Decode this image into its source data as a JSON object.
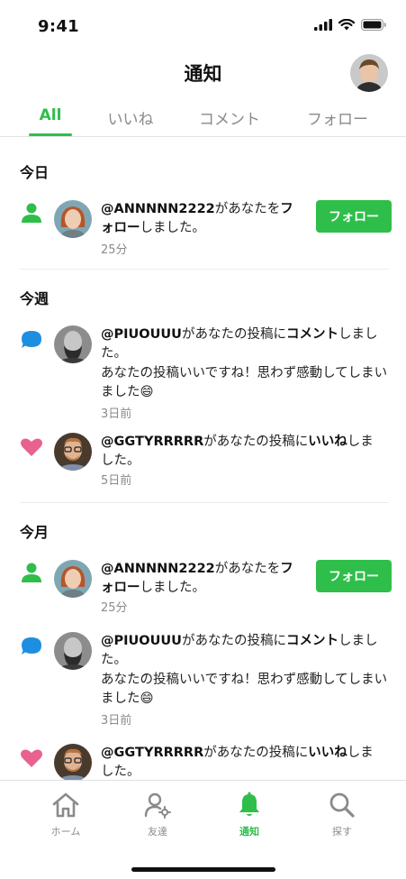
{
  "status": {
    "time": "9:41"
  },
  "header": {
    "title": "通知"
  },
  "tabs": [
    {
      "label": "All",
      "active": true
    },
    {
      "label": "いいね",
      "active": false
    },
    {
      "label": "コメント",
      "active": false
    },
    {
      "label": "フォロー",
      "active": false
    }
  ],
  "sections": {
    "today": "今日",
    "week": "今週",
    "month": "今月"
  },
  "notifications": {
    "follow1": {
      "user": "@ANNNNN2222",
      "pre": "があなたを",
      "action": "フォロー",
      "post": "しました。",
      "time": "25分",
      "button": "フォロー"
    },
    "comment1": {
      "user": "@PIUOUUU",
      "pre": "があなたの投稿に",
      "action": "コメント",
      "post": "しました。",
      "body": "あなたの投稿いいですね！思わず感動してしまいました😄",
      "time": "3日前"
    },
    "like1": {
      "user": "@GGTYRRRRR",
      "pre": "があなたの投稿に",
      "action": "いいね",
      "post": "しました。",
      "time": "5日前"
    },
    "follow2": {
      "user": "@ANNNNN2222",
      "pre": "があなたを",
      "action": "フォロー",
      "post": "しました。",
      "time": "25分",
      "button": "フォロー"
    },
    "comment2": {
      "user": "@PIUOUUU",
      "pre": "があなたの投稿に",
      "action": "コメント",
      "post": "しました。",
      "body": "あなたの投稿いいですね！思わず感動してしまいました😄",
      "time": "3日前"
    },
    "like2": {
      "user": "@GGTYRRRRR",
      "pre": "があなたの投稿に",
      "action": "いいね",
      "post": "しました。"
    }
  },
  "nav": [
    {
      "label": "ホーム",
      "icon": "home-icon"
    },
    {
      "label": "友達",
      "icon": "friends-icon"
    },
    {
      "label": "通知",
      "icon": "bell-icon",
      "active": true
    },
    {
      "label": "探す",
      "icon": "search-icon"
    }
  ],
  "colors": {
    "accent": "#2fbe4a",
    "like": "#e8628e",
    "comment": "#1e8ee0"
  }
}
